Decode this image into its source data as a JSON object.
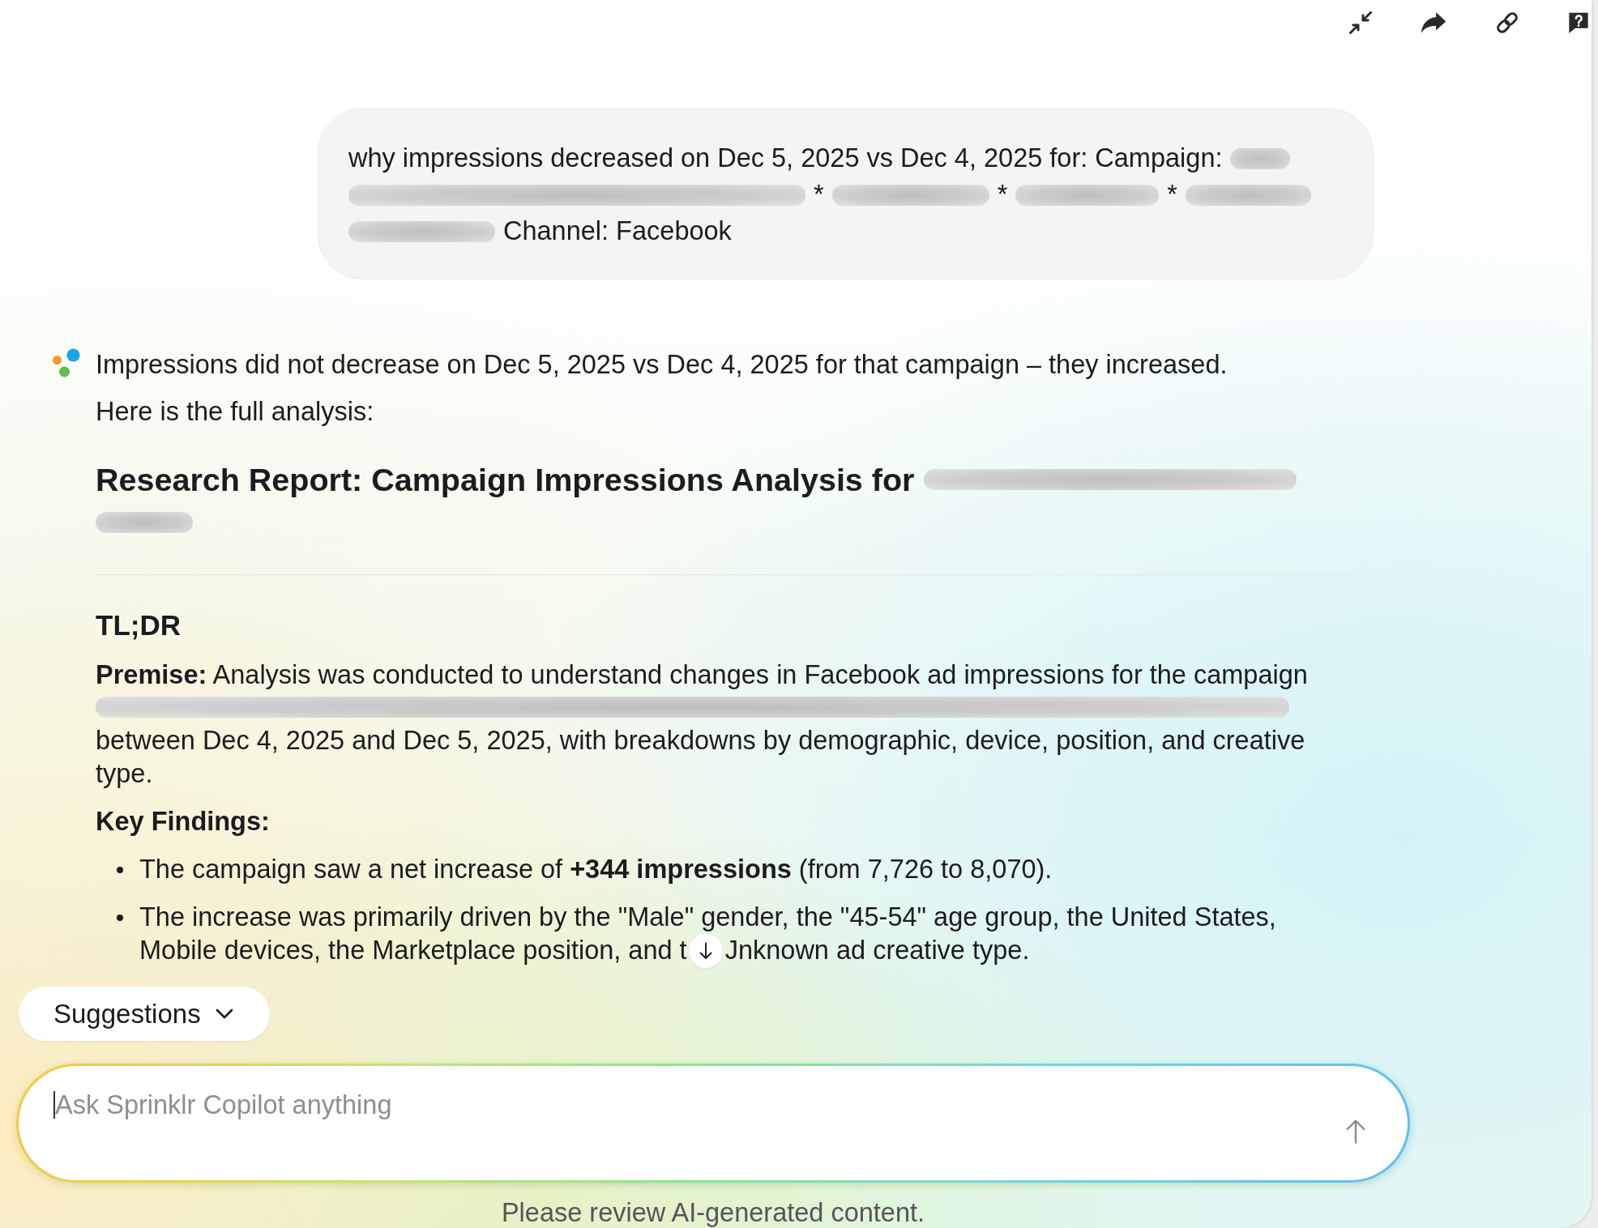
{
  "user_message": {
    "lines": [
      [
        {
          "kind": "text",
          "text": "why impressions decreased on Dec 5, 2025 vs Dec 4, 2025 for: Campaign:"
        },
        {
          "kind": "redacted"
        }
      ],
      [
        {
          "kind": "redacted"
        },
        {
          "kind": "text",
          "text": "*"
        },
        {
          "kind": "redacted"
        },
        {
          "kind": "text",
          "text": "*"
        },
        {
          "kind": "redacted"
        },
        {
          "kind": "text",
          "text": "*"
        },
        {
          "kind": "redacted"
        }
      ],
      [
        {
          "kind": "redacted"
        },
        {
          "kind": "text",
          "text": "Channel: Facebook"
        }
      ]
    ]
  },
  "assistant_message": {
    "intro": "Impressions did not decrease on Dec 5, 2025 vs Dec 4, 2025 for that campaign – they increased.",
    "lead": "Here is the full analysis:",
    "report": {
      "title": [
        {
          "kind": "text",
          "text": "Research Report: Campaign Impressions Analysis for"
        },
        {
          "kind": "redacted"
        },
        {
          "kind": "redacted"
        }
      ],
      "tldr_heading": "TL;DR",
      "premise": [
        {
          "kind": "text",
          "text": "**Premise:** Analysis was conducted to understand changes in Facebook ad impressions for the campaign"
        },
        {
          "kind": "redacted"
        },
        {
          "kind": "text",
          "text": "between Dec 4, 2025 and Dec 5, 2025, with breakdowns by demographic, device, position, and creative type."
        }
      ],
      "key_findings_heading": "Key Findings:",
      "key_findings": [
        {
          "lines": [
            [
              {
                "kind": "text",
                "text": "The campaign saw a net increase of **+344 impressions** (from 7,726 to 8,070)."
              }
            ]
          ]
        },
        {
          "lines": [
            [
              {
                "kind": "text",
                "text": "The increase was primarily driven by the \"Male\" gender, the \"45-54\" age group, the United States,"
              }
            ],
            [
              {
                "kind": "text",
                "text": "Mobile devices, the Marketplace position, and t"
              },
              {
                "kind": "scroll_button"
              },
              {
                "kind": "text",
                "text": "Jnknown ad creative type."
              }
            ]
          ]
        }
      ]
    }
  },
  "suggestions_button": {
    "label": "Suggestions"
  },
  "composer": {
    "placeholder": "Ask Sprinklr Copilot anything"
  },
  "disclaimer": "Please review AI-generated content."
}
